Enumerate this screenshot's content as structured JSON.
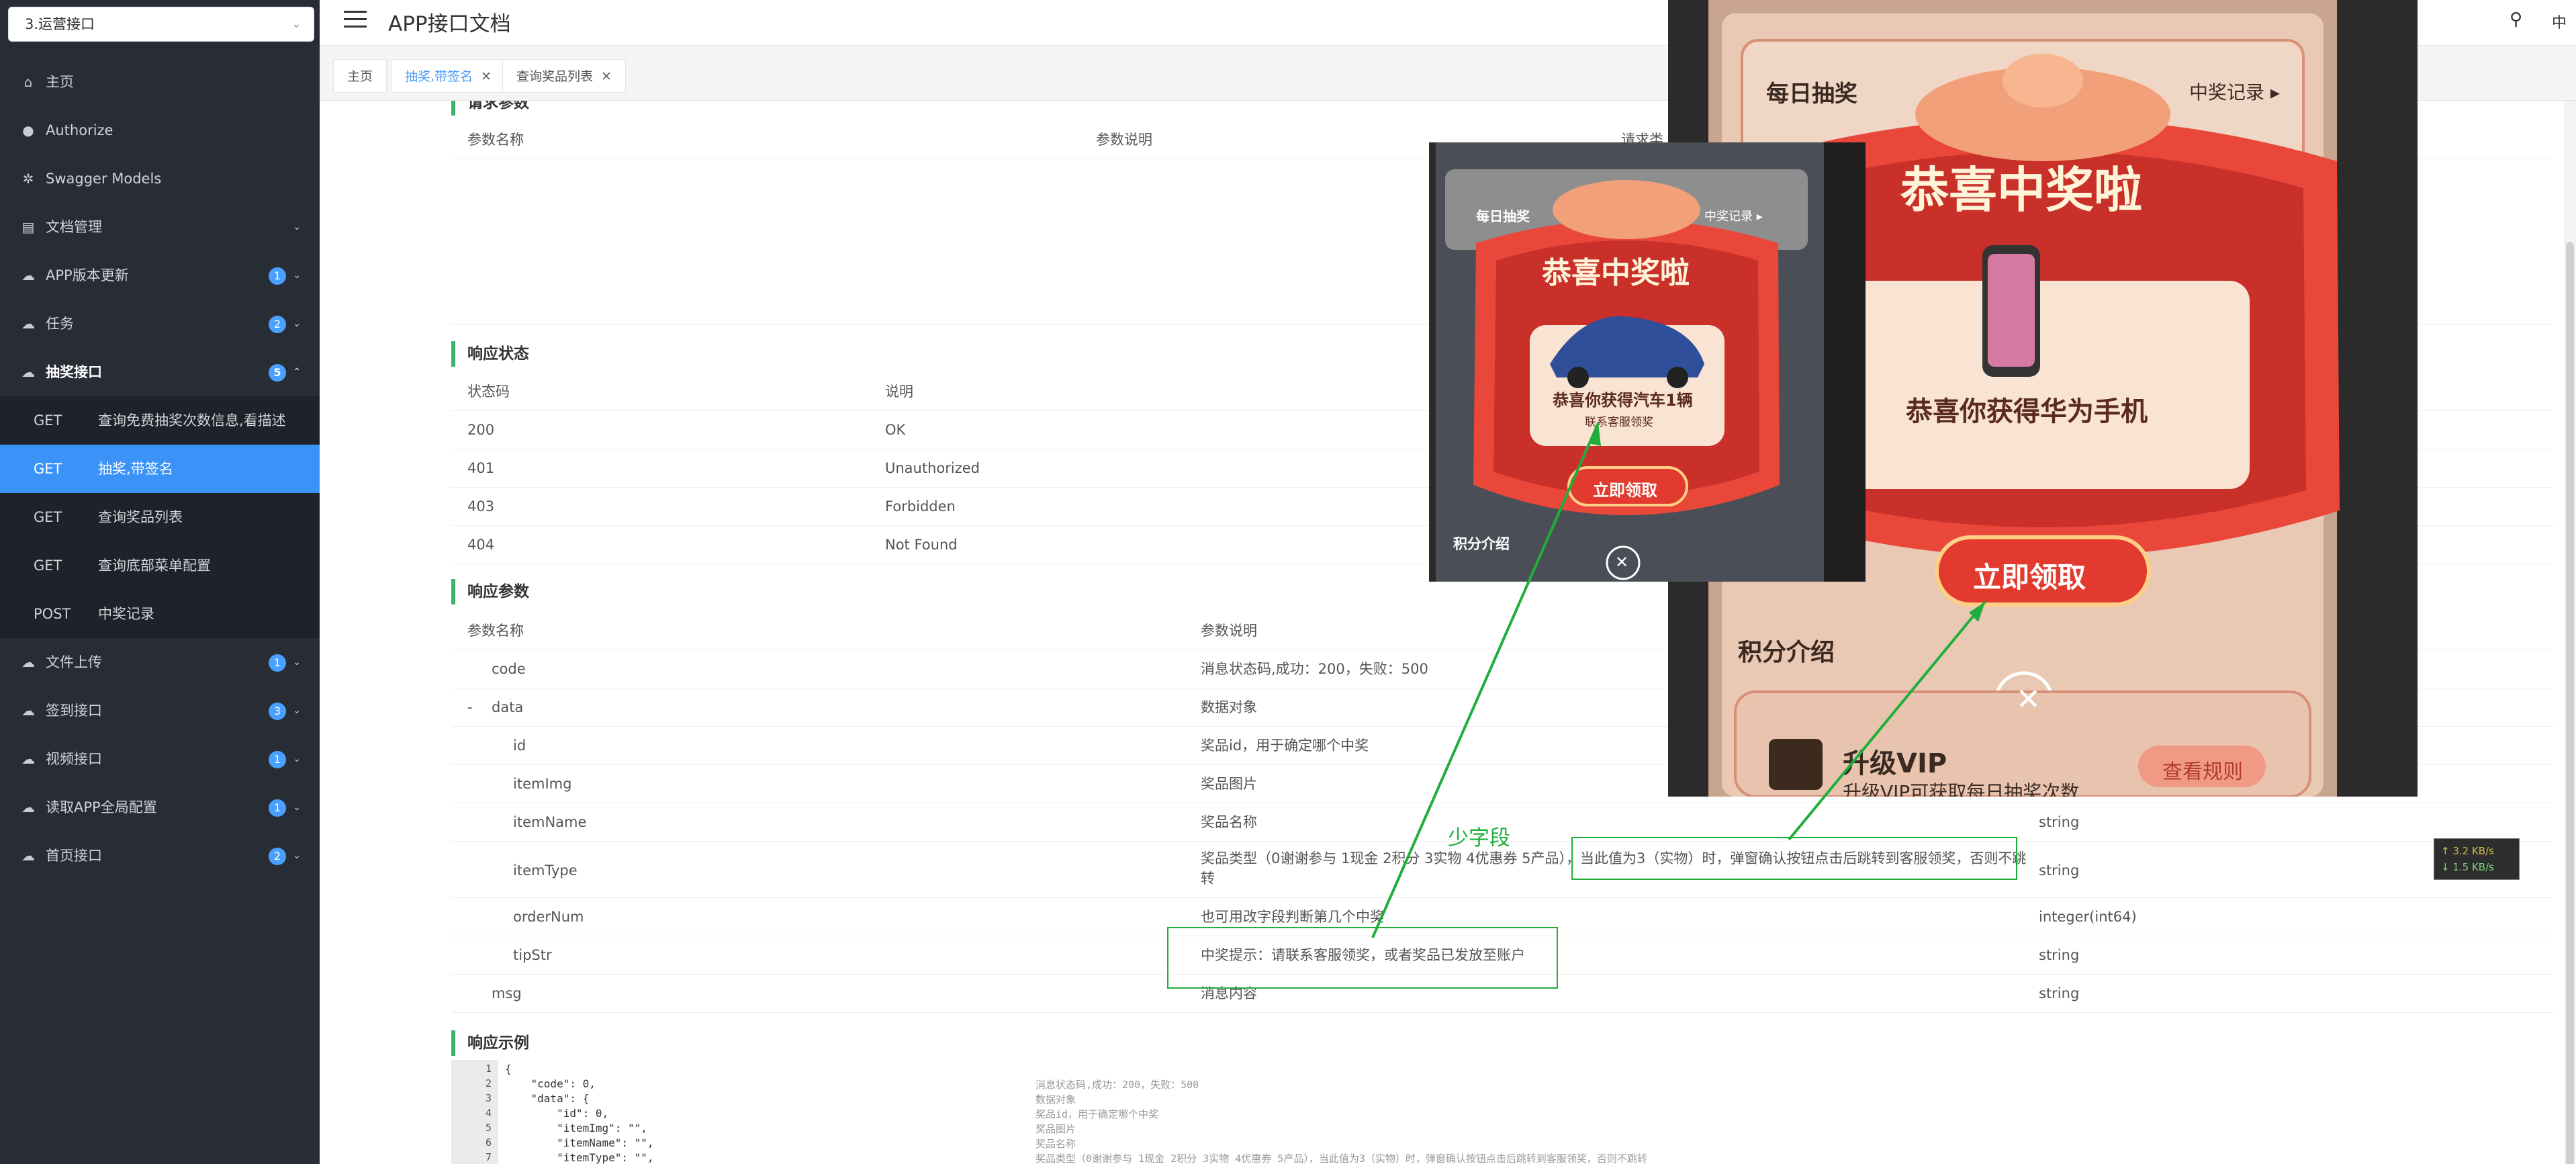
{
  "sidebar": {
    "project_select": "3.运营接口",
    "nav": [
      {
        "label": "主页",
        "icon": "home-icon",
        "glyph": "⌂"
      },
      {
        "label": "Authorize",
        "icon": "lock-icon",
        "glyph": "●"
      },
      {
        "label": "Swagger Models",
        "icon": "model-icon",
        "glyph": "✲"
      },
      {
        "label": "文档管理",
        "icon": "doc-icon",
        "glyph": "▤",
        "arrow": "⌄"
      }
    ],
    "groups": [
      {
        "label": "APP版本更新",
        "badge": "1"
      },
      {
        "label": "任务",
        "badge": "2"
      },
      {
        "label": "抽奖接口",
        "badge": "5",
        "expanded": true
      }
    ],
    "sub_items": [
      {
        "method": "GET",
        "title": "查询免费抽奖次数信息,看描述"
      },
      {
        "method": "GET",
        "title": "抽奖,带签名",
        "selected": true
      },
      {
        "method": "GET",
        "title": "查询奖品列表"
      },
      {
        "method": "GET",
        "title": "查询底部菜单配置"
      },
      {
        "method": "POST",
        "title": "中奖记录"
      }
    ],
    "groups_after": [
      {
        "label": "文件上传",
        "badge": "1"
      },
      {
        "label": "签到接口",
        "badge": "3"
      },
      {
        "label": "视频接口",
        "badge": "1"
      },
      {
        "label": "读取APP全局配置",
        "badge": "1"
      },
      {
        "label": "首页接口",
        "badge": "2"
      }
    ]
  },
  "header": {
    "title": "APP接口文档",
    "lang": "中"
  },
  "tabs": [
    {
      "label": "主页"
    },
    {
      "label": "抽奖,带签名",
      "active": true
    },
    {
      "label": "查询奖品列表"
    }
  ],
  "request_params": {
    "title": "请求参数",
    "col_name": "参数名称",
    "col_desc": "参数说明",
    "col_type": "请求类"
  },
  "response_status": {
    "title": "响应状态",
    "col_code": "状态码",
    "col_desc": "说明",
    "rows": [
      {
        "code": "200",
        "desc": "OK"
      },
      {
        "code": "401",
        "desc": "Unauthorized"
      },
      {
        "code": "403",
        "desc": "Forbidden"
      },
      {
        "code": "404",
        "desc": "Not Found"
      }
    ]
  },
  "response_params": {
    "title": "响应参数",
    "col_name": "参数名称",
    "col_desc": "参数说明",
    "rows": [
      {
        "name": "code",
        "desc": "消息状态码,成功：200，失败：500",
        "type": ""
      },
      {
        "name": "data",
        "toggle": "-",
        "desc": "数据对象",
        "type": ""
      },
      {
        "name": "id",
        "desc": "奖品id，用于确定哪个中奖",
        "type": ""
      },
      {
        "name": "itemImg",
        "desc": "奖品图片",
        "type": ""
      },
      {
        "name": "itemName",
        "desc": "奖品名称",
        "type": "string"
      },
      {
        "name": "itemType",
        "desc": "奖品类型（0谢谢参与 1现金 2积分 3实物 4优惠券 5产品），当此值为3（实物）时，弹窗确认按钮点击后跳转到客服领奖，否则不跳",
        "desc2": "转",
        "type": "string"
      },
      {
        "name": "orderNum",
        "desc": "也可用改字段判断第几个中奖",
        "type": "integer(int64)"
      },
      {
        "name": "tipStr",
        "desc": "中奖提示：请联系客服领奖，或者奖品已发放至账户",
        "type": "string"
      },
      {
        "name": "msg",
        "desc": "消息内容",
        "type": "string"
      }
    ]
  },
  "response_example": {
    "title": "响应示例",
    "lines": [
      {
        "n": "1",
        "code": "{",
        "comment": ""
      },
      {
        "n": "2",
        "code": "    \"code\": 0,",
        "comment": "消息状态码,成功：200，失败：500"
      },
      {
        "n": "3",
        "code": "    \"data\": {",
        "comment": "数据对象"
      },
      {
        "n": "4",
        "code": "        \"id\": 0,",
        "comment": "奖品id，用于确定哪个中奖"
      },
      {
        "n": "5",
        "code": "        \"itemImg\": \"\",",
        "comment": "奖品图片"
      },
      {
        "n": "6",
        "code": "        \"itemName\": \"\",",
        "comment": "奖品名称"
      },
      {
        "n": "7",
        "code": "        \"itemType\": \"\",",
        "comment": "奖品类型（0谢谢参与 1现金 2积分 3实物 4优惠券 5产品），当此值为3（实物）时，弹窗确认按钮点击后跳转到客服领奖，否则不跳转"
      }
    ]
  },
  "annotation": {
    "label": "少字段"
  },
  "speed": {
    "up": "↑ 3.2 KB/s",
    "down": "↓ 1.5 KB/s"
  },
  "popup_big": {
    "daily": "每日抽奖",
    "record": "中奖记录 ▸",
    "congrats": "恭喜中奖啦",
    "prize_text": "恭喜你获得华为手机",
    "claim": "立即领取",
    "points": "积分介绍",
    "vip": "升级VIP",
    "vip_sub": "升级VIP可获取每日抽奖次数",
    "rules": "查看规则",
    "close": "✕"
  },
  "popup_small": {
    "daily": "每日抽奖",
    "record": "中奖记录 ▸",
    "congrats": "恭喜中奖啦",
    "prize_text": "恭喜你获得汽车1辆",
    "prize_sub": "联系客服领奖",
    "claim": "立即领取",
    "points": "积分介绍",
    "close": "✕"
  },
  "colors": {
    "accent": "#3b93f7",
    "annotation": "#1fae3b",
    "sidebar": "#282c34",
    "popup_red": "#e8473a"
  }
}
